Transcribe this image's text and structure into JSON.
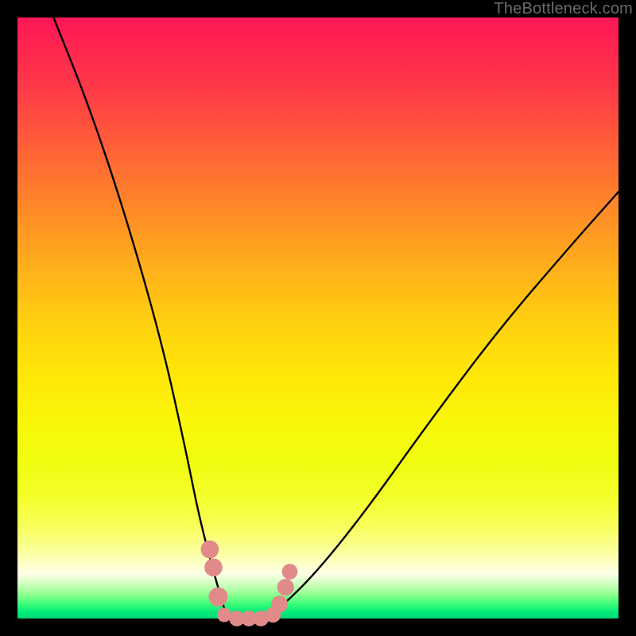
{
  "watermark": "TheBottleneck.com",
  "colors": {
    "frame": "#000000",
    "curve": "#000000",
    "marker_fill": "#e08a8a",
    "marker_stroke": "#c86a6a"
  },
  "chart_data": {
    "type": "line",
    "title": "",
    "xlabel": "",
    "ylabel": "",
    "xlim": [
      0,
      100
    ],
    "ylim": [
      0,
      100
    ],
    "grid": false,
    "legend": false,
    "series": [
      {
        "name": "left-branch",
        "x": [
          6,
          12,
          18,
          24,
          28,
          30,
          32,
          34,
          34.6,
          35.2
        ],
        "y": [
          100,
          85,
          67,
          46,
          28,
          18,
          10,
          3,
          1,
          0
        ],
        "comment": "Steep descending curve from top-left corner into the valley"
      },
      {
        "name": "right-branch",
        "x": [
          41,
          44,
          50,
          58,
          68,
          80,
          92,
          100
        ],
        "y": [
          0,
          2,
          8,
          18,
          32,
          48,
          62,
          71
        ],
        "comment": "Ascending curve from valley floor toward upper right; exits right edge ~71% height"
      },
      {
        "name": "valley-floor",
        "x": [
          35.2,
          41
        ],
        "y": [
          0,
          0
        ],
        "comment": "Short flat segment connecting the two branches"
      }
    ],
    "markers": {
      "comment": "Salmon circular markers on/near the valley, left and right clusters plus a flat bottom band",
      "points": [
        {
          "x": 32.0,
          "y": 11.5,
          "r": 1.5
        },
        {
          "x": 32.6,
          "y": 8.5,
          "r": 1.5
        },
        {
          "x": 33.4,
          "y": 3.6,
          "r": 1.6
        },
        {
          "x": 34.4,
          "y": 0.6,
          "r": 1.2
        },
        {
          "x": 36.5,
          "y": 0.0,
          "r": 1.3
        },
        {
          "x": 38.5,
          "y": 0.0,
          "r": 1.3
        },
        {
          "x": 40.5,
          "y": 0.0,
          "r": 1.3
        },
        {
          "x": 42.5,
          "y": 0.6,
          "r": 1.3
        },
        {
          "x": 43.6,
          "y": 2.4,
          "r": 1.4
        },
        {
          "x": 44.6,
          "y": 5.2,
          "r": 1.4
        },
        {
          "x": 45.3,
          "y": 7.8,
          "r": 1.3
        }
      ]
    }
  }
}
